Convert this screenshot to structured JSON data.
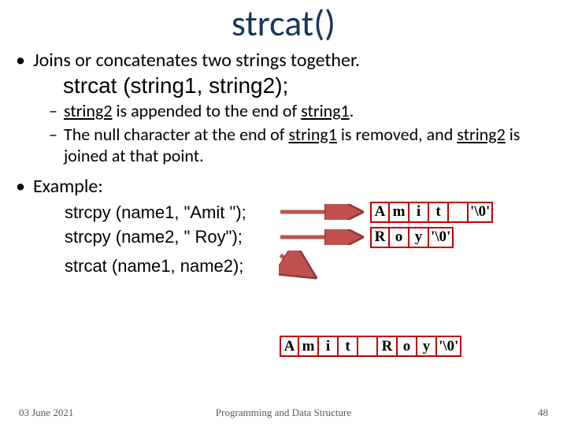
{
  "title": "strcat()",
  "main_bullet": "Joins or concatenates two strings together.",
  "syntax": "strcat  (string1, string2);",
  "sub1_pre": "",
  "sub1_u1": "string2",
  "sub1_mid": " is appended to the end of ",
  "sub1_u2": "string1",
  "sub1_post": ".",
  "sub2_pre": "The null character at the end of ",
  "sub2_u1": "string1",
  "sub2_mid": " is removed, and ",
  "sub2_u2": "string2",
  "sub2_post": " is joined at that point.",
  "example_label": "Example:",
  "code1": "strcpy (name1, \"Amit \");",
  "code2": "strcpy (name2, \" Roy\");",
  "code3": "strcat  (name1, name2);",
  "mem1": [
    "A",
    "m",
    "i",
    "t",
    "",
    "'\\0'"
  ],
  "mem2": [
    "R",
    "o",
    "y",
    "'\\0'"
  ],
  "mem3": [
    "A",
    "m",
    "i",
    "t",
    "",
    "R",
    "o",
    "y",
    "'\\0'"
  ],
  "footer": {
    "date": "03 June 2021",
    "course": "Programming and Data Structure",
    "page": "48"
  },
  "colors": {
    "title": "#17365d",
    "border": "#c00000",
    "arrow_fill": "#c0504d",
    "arrow_stroke": "#8c3836"
  }
}
